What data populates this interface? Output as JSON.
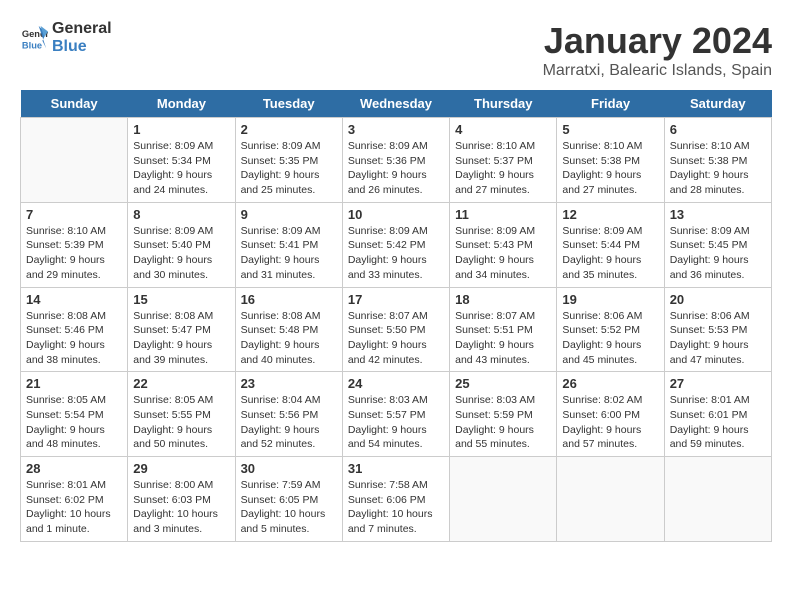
{
  "header": {
    "logo_general": "General",
    "logo_blue": "Blue",
    "title": "January 2024",
    "subtitle": "Marratxi, Balearic Islands, Spain"
  },
  "days_of_week": [
    "Sunday",
    "Monday",
    "Tuesday",
    "Wednesday",
    "Thursday",
    "Friday",
    "Saturday"
  ],
  "weeks": [
    [
      {
        "day": "",
        "info": ""
      },
      {
        "day": "1",
        "info": "Sunrise: 8:09 AM\nSunset: 5:34 PM\nDaylight: 9 hours\nand 24 minutes."
      },
      {
        "day": "2",
        "info": "Sunrise: 8:09 AM\nSunset: 5:35 PM\nDaylight: 9 hours\nand 25 minutes."
      },
      {
        "day": "3",
        "info": "Sunrise: 8:09 AM\nSunset: 5:36 PM\nDaylight: 9 hours\nand 26 minutes."
      },
      {
        "day": "4",
        "info": "Sunrise: 8:10 AM\nSunset: 5:37 PM\nDaylight: 9 hours\nand 27 minutes."
      },
      {
        "day": "5",
        "info": "Sunrise: 8:10 AM\nSunset: 5:38 PM\nDaylight: 9 hours\nand 27 minutes."
      },
      {
        "day": "6",
        "info": "Sunrise: 8:10 AM\nSunset: 5:38 PM\nDaylight: 9 hours\nand 28 minutes."
      }
    ],
    [
      {
        "day": "7",
        "info": "Sunrise: 8:10 AM\nSunset: 5:39 PM\nDaylight: 9 hours\nand 29 minutes."
      },
      {
        "day": "8",
        "info": "Sunrise: 8:09 AM\nSunset: 5:40 PM\nDaylight: 9 hours\nand 30 minutes."
      },
      {
        "day": "9",
        "info": "Sunrise: 8:09 AM\nSunset: 5:41 PM\nDaylight: 9 hours\nand 31 minutes."
      },
      {
        "day": "10",
        "info": "Sunrise: 8:09 AM\nSunset: 5:42 PM\nDaylight: 9 hours\nand 33 minutes."
      },
      {
        "day": "11",
        "info": "Sunrise: 8:09 AM\nSunset: 5:43 PM\nDaylight: 9 hours\nand 34 minutes."
      },
      {
        "day": "12",
        "info": "Sunrise: 8:09 AM\nSunset: 5:44 PM\nDaylight: 9 hours\nand 35 minutes."
      },
      {
        "day": "13",
        "info": "Sunrise: 8:09 AM\nSunset: 5:45 PM\nDaylight: 9 hours\nand 36 minutes."
      }
    ],
    [
      {
        "day": "14",
        "info": "Sunrise: 8:08 AM\nSunset: 5:46 PM\nDaylight: 9 hours\nand 38 minutes."
      },
      {
        "day": "15",
        "info": "Sunrise: 8:08 AM\nSunset: 5:47 PM\nDaylight: 9 hours\nand 39 minutes."
      },
      {
        "day": "16",
        "info": "Sunrise: 8:08 AM\nSunset: 5:48 PM\nDaylight: 9 hours\nand 40 minutes."
      },
      {
        "day": "17",
        "info": "Sunrise: 8:07 AM\nSunset: 5:50 PM\nDaylight: 9 hours\nand 42 minutes."
      },
      {
        "day": "18",
        "info": "Sunrise: 8:07 AM\nSunset: 5:51 PM\nDaylight: 9 hours\nand 43 minutes."
      },
      {
        "day": "19",
        "info": "Sunrise: 8:06 AM\nSunset: 5:52 PM\nDaylight: 9 hours\nand 45 minutes."
      },
      {
        "day": "20",
        "info": "Sunrise: 8:06 AM\nSunset: 5:53 PM\nDaylight: 9 hours\nand 47 minutes."
      }
    ],
    [
      {
        "day": "21",
        "info": "Sunrise: 8:05 AM\nSunset: 5:54 PM\nDaylight: 9 hours\nand 48 minutes."
      },
      {
        "day": "22",
        "info": "Sunrise: 8:05 AM\nSunset: 5:55 PM\nDaylight: 9 hours\nand 50 minutes."
      },
      {
        "day": "23",
        "info": "Sunrise: 8:04 AM\nSunset: 5:56 PM\nDaylight: 9 hours\nand 52 minutes."
      },
      {
        "day": "24",
        "info": "Sunrise: 8:03 AM\nSunset: 5:57 PM\nDaylight: 9 hours\nand 54 minutes."
      },
      {
        "day": "25",
        "info": "Sunrise: 8:03 AM\nSunset: 5:59 PM\nDaylight: 9 hours\nand 55 minutes."
      },
      {
        "day": "26",
        "info": "Sunrise: 8:02 AM\nSunset: 6:00 PM\nDaylight: 9 hours\nand 57 minutes."
      },
      {
        "day": "27",
        "info": "Sunrise: 8:01 AM\nSunset: 6:01 PM\nDaylight: 9 hours\nand 59 minutes."
      }
    ],
    [
      {
        "day": "28",
        "info": "Sunrise: 8:01 AM\nSunset: 6:02 PM\nDaylight: 10 hours\nand 1 minute."
      },
      {
        "day": "29",
        "info": "Sunrise: 8:00 AM\nSunset: 6:03 PM\nDaylight: 10 hours\nand 3 minutes."
      },
      {
        "day": "30",
        "info": "Sunrise: 7:59 AM\nSunset: 6:05 PM\nDaylight: 10 hours\nand 5 minutes."
      },
      {
        "day": "31",
        "info": "Sunrise: 7:58 AM\nSunset: 6:06 PM\nDaylight: 10 hours\nand 7 minutes."
      },
      {
        "day": "",
        "info": ""
      },
      {
        "day": "",
        "info": ""
      },
      {
        "day": "",
        "info": ""
      }
    ]
  ]
}
